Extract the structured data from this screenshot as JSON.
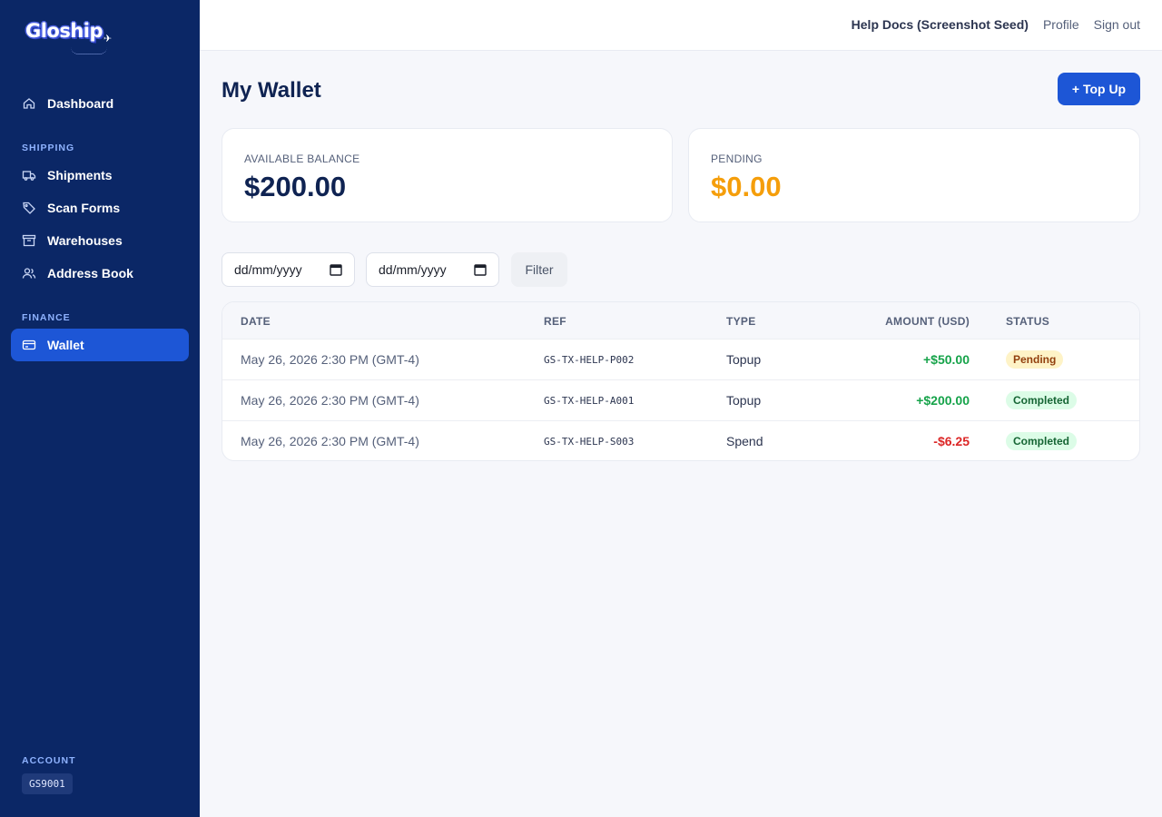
{
  "brand": {
    "name": "Gloship"
  },
  "sidebar": {
    "dashboard": "Dashboard",
    "shipping_label": "SHIPPING",
    "shipping_items": [
      "Shipments",
      "Scan Forms",
      "Warehouses",
      "Address Book"
    ],
    "finance_label": "FINANCE",
    "wallet": "Wallet",
    "account_label": "ACCOUNT",
    "account_id": "GS9001"
  },
  "topbar": {
    "user": "Help Docs (Screenshot Seed)",
    "profile": "Profile",
    "signout": "Sign out"
  },
  "page": {
    "title": "My Wallet",
    "topup_label": "+ Top Up"
  },
  "cards": {
    "balance_label": "AVAILABLE BALANCE",
    "balance_value": "$200.00",
    "pending_label": "PENDING",
    "pending_value": "$0.00"
  },
  "filters": {
    "from_placeholder": "dd/mm/yyyy",
    "to_placeholder": "dd/mm/yyyy",
    "filter_label": "Filter"
  },
  "table": {
    "headers": {
      "date": "DATE",
      "ref": "REF",
      "type": "TYPE",
      "amount": "AMOUNT (USD)",
      "status": "STATUS"
    },
    "rows": [
      {
        "date": "May 26, 2026 2:30 PM (GMT-4)",
        "ref": "GS-TX-HELP-P002",
        "type": "Topup",
        "amount": "+$50.00",
        "status": "Pending"
      },
      {
        "date": "May 26, 2026 2:30 PM (GMT-4)",
        "ref": "GS-TX-HELP-A001",
        "type": "Topup",
        "amount": "+$200.00",
        "status": "Completed"
      },
      {
        "date": "May 26, 2026 2:30 PM (GMT-4)",
        "ref": "GS-TX-HELP-S003",
        "type": "Spend",
        "amount": "-$6.25",
        "status": "Completed"
      }
    ]
  },
  "colors": {
    "sidebar_bg": "#0b2766",
    "accent": "#1d56d6",
    "positive": "#16a34a",
    "negative": "#dc2626",
    "pending": "#f59e0b"
  }
}
